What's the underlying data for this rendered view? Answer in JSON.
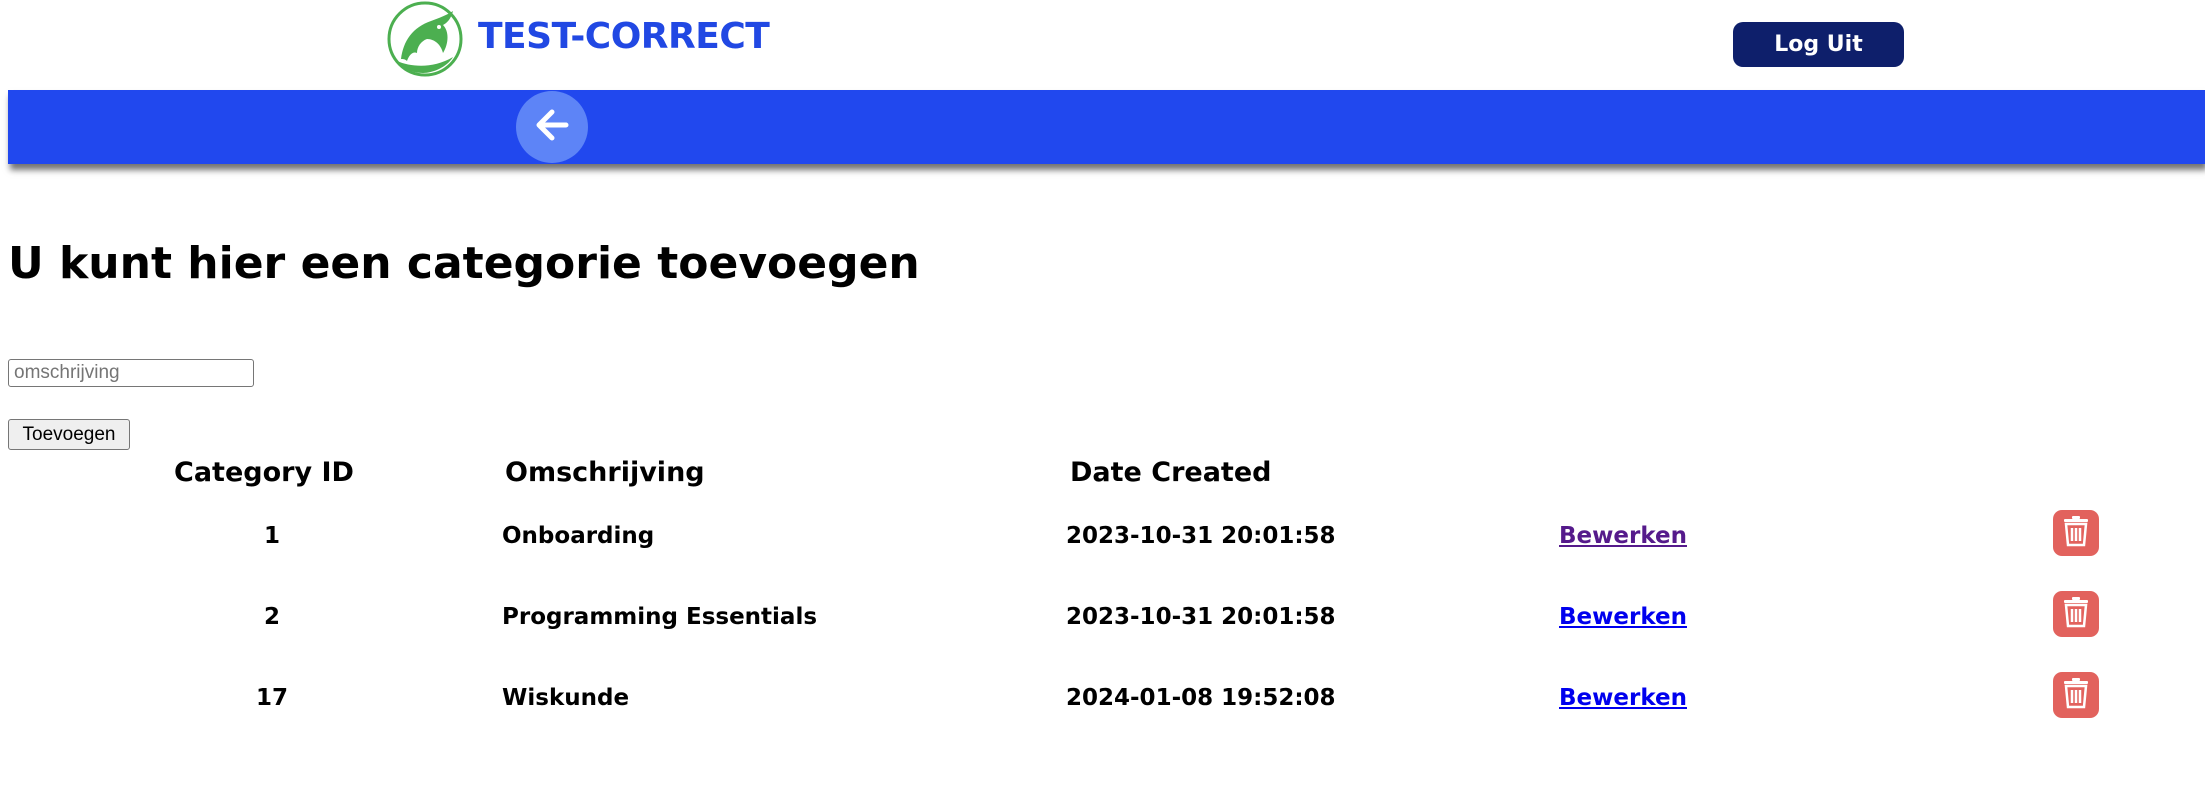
{
  "header": {
    "brand": "TEST-CORRECT",
    "logo_icon": "dolphin-logo-icon",
    "logout_label": "Log Uit",
    "colors": {
      "brand": "#2148e3",
      "logout_bg": "#0e1f6b"
    }
  },
  "navbar": {
    "back_icon": "arrow-left-icon",
    "colors": {
      "bar": "#2148ee",
      "back_circle": "#5d84f7"
    }
  },
  "main": {
    "title": "U kunt hier een categorie toevoegen",
    "description_input": {
      "value": "",
      "placeholder": "omschrijving"
    },
    "add_button_label": "Toevoegen"
  },
  "table": {
    "headers": [
      "Category ID",
      "Omschrijving",
      "Date Created"
    ],
    "rows": [
      {
        "id": "1",
        "description": "Onboarding",
        "date_created": "2023-10-31 20:01:58",
        "edit_label": "Bewerken",
        "edit_visited": true,
        "delete_icon": "trash-icon"
      },
      {
        "id": "2",
        "description": "Programming Essentials",
        "date_created": "2023-10-31 20:01:58",
        "edit_label": "Bewerken",
        "edit_visited": false,
        "delete_icon": "trash-icon"
      },
      {
        "id": "17",
        "description": "Wiskunde",
        "date_created": "2024-01-08 19:52:08",
        "edit_label": "Bewerken",
        "edit_visited": false,
        "delete_icon": "trash-icon"
      }
    ],
    "colors": {
      "link": "#0000ee",
      "link_visited": "#551a8b",
      "delete_bg": "#e2625d"
    }
  }
}
